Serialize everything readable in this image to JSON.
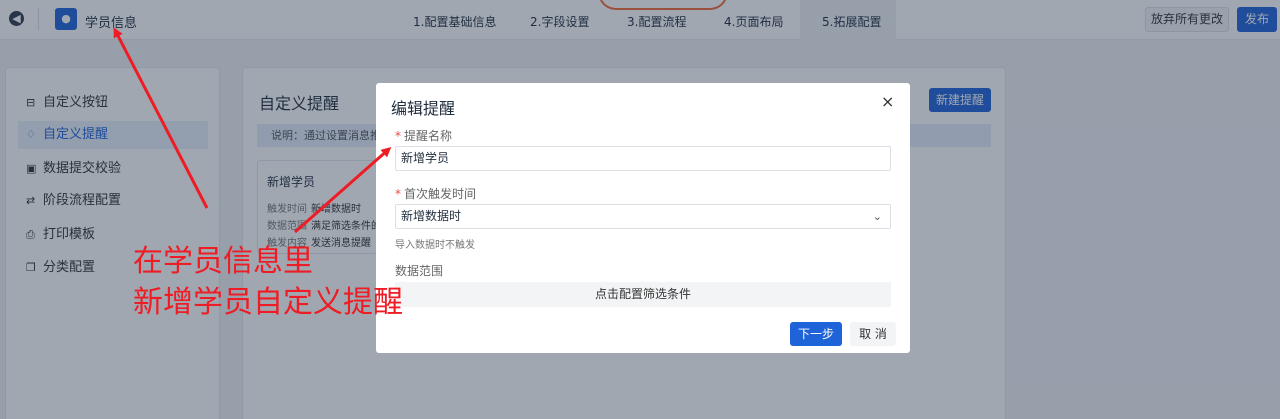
{
  "header": {
    "app_title": "学员信息",
    "steps": [
      "1.配置基础信息",
      "2.字段设置",
      "3.配置流程",
      "4.页面布局",
      "5.拓展配置"
    ],
    "discard_label": "放弃所有更改",
    "publish_label": "发布"
  },
  "sidebar": {
    "items": [
      {
        "label": "自定义按钮",
        "icon": "⊟"
      },
      {
        "label": "自定义提醒",
        "icon": "♢"
      },
      {
        "label": "数据提交校验",
        "icon": "▣"
      },
      {
        "label": "阶段流程配置",
        "icon": "⇄"
      },
      {
        "label": "打印模板",
        "icon": "⎙"
      },
      {
        "label": "分类配置",
        "icon": "❐"
      }
    ]
  },
  "main": {
    "title": "自定义提醒",
    "new_button": "新建提醒",
    "notice": "说明：通过设置消息推送提",
    "card": {
      "title": "新增学员",
      "rows": [
        {
          "key": "触发时间",
          "value": "新增数据时"
        },
        {
          "key": "数据范围",
          "value": "满足筛选条件的数"
        },
        {
          "key": "触发内容",
          "value": "发送消息提醒"
        }
      ]
    }
  },
  "dialog": {
    "title": "编辑提醒",
    "close": "×",
    "name_label": "提醒名称",
    "name_value": "新增学员",
    "trigger_label": "首次触发时间",
    "trigger_value": "新增数据时",
    "trigger_hint": "导入数据时不触发",
    "range_label": "数据范围",
    "range_button": "点击配置筛选条件",
    "next_label": "下一步",
    "cancel_label": "取 消"
  },
  "annotation": {
    "line1": "在学员信息里",
    "line2": "新增学员自定义提醒",
    "color": "#ee1c24"
  }
}
